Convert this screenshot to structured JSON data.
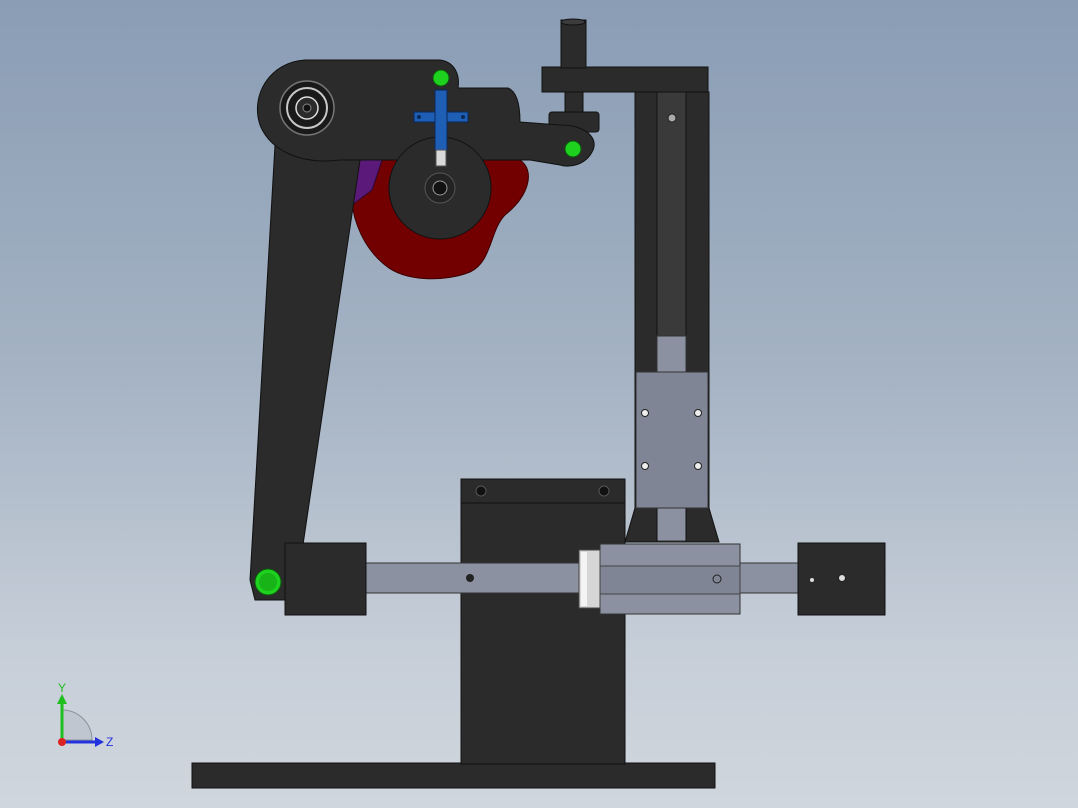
{
  "viewport": {
    "background_top": "#8a9db5",
    "background_bottom": "#d0d6dd"
  },
  "model": {
    "part_colors": {
      "frame": "#2b2b2b",
      "cam": "#720000",
      "cam_accent": "#5b1a7a",
      "pin": "#1fd11f",
      "follower_bracket": "#1e5fb5",
      "slide_block": "#7f8594",
      "rail": "#8c91a2",
      "bearing_ring": "#c8c8c8"
    }
  },
  "triad": {
    "y_label": "Y",
    "z_label": "Z",
    "colors": {
      "y": "#1fbf1f",
      "z": "#2233dd",
      "x": "#dd2222"
    }
  }
}
